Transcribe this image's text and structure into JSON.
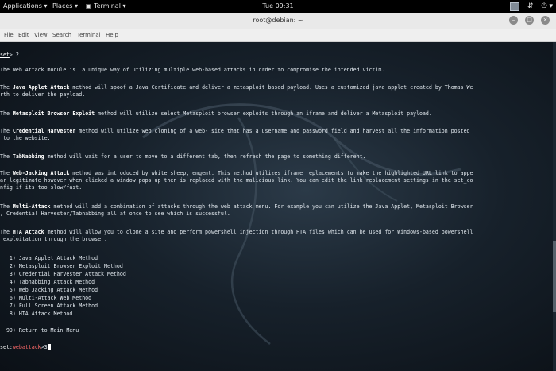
{
  "topbar": {
    "applications": "Applications ▾",
    "places": "Places ▾",
    "terminal": "▣ Terminal ▾",
    "clock": "Tue 09:31",
    "tray_network": "⇵",
    "tray_power": "⏻ ▾"
  },
  "window": {
    "title": "root@debian: ~",
    "minimize": "–",
    "maximize": "□",
    "close": "×"
  },
  "menubar": {
    "file": "File",
    "edit": "Edit",
    "view": "View",
    "search": "Search",
    "terminal": "Terminal",
    "help": "Help"
  },
  "terminal": {
    "prompt1_label": "set",
    "prompt1_suffix": "> 2",
    "intro": "The Web Attack module is  a unique way of utilizing multiple web-based attacks in order to compromise the intended victim.",
    "java_name": "Java Applet Attack",
    "java_a": "The ",
    "java_b": " method will spoof a Java Certificate and deliver a metasploit based payload. Uses a customized java applet created by Thomas We",
    "java_c": "rth to deliver the payload.",
    "msf_a": "The ",
    "msf_name": "Metasploit Browser Exploit",
    "msf_b": " method will utilize select Metasploit browser exploits through an iframe and deliver a Metasploit payload.",
    "cred_a": "The ",
    "cred_name": "Credential Harvester",
    "cred_b": " method will utilize web cloning of a web- site that has a username and password field and harvest all the information posted",
    "cred_c": " to the website.",
    "tab_a": "The ",
    "tab_name": "TabNabbing",
    "tab_b": " method will wait for a user to move to a different tab, then refresh the page to something different.",
    "wj_a": "The ",
    "wj_name": "Web-Jacking Attack",
    "wj_b": " method was introduced by white sheep, emgent. This method utilizes iframe replacements to make the highlighted URL link to appe",
    "wj_c": "ar legitimate however when clicked a window pops up then is replaced with the malicious link. You can edit the link replacement settings in the set_co",
    "wj_d": "nfig if its too slow/fast.",
    "multi_a": "The ",
    "multi_name": "Multi-Attack",
    "multi_b": " method will add a combination of attacks through the web attack menu. For example you can utilize the Java Applet, Metasploit Browser",
    "multi_c": ", Credential Harvester/Tabnabbing all at once to see which is successful.",
    "hta_a": "The ",
    "hta_name": "HTA Attack",
    "hta_b": " method will allow you to clone a site and perform powershell injection through HTA files which can be used for Windows-based powershell",
    "hta_c": " exploitation through the browser.",
    "menu": [
      "   1) Java Applet Attack Method",
      "   2) Metasploit Browser Exploit Method",
      "   3) Credential Harvester Attack Method",
      "   4) Tabnabbing Attack Method",
      "   5) Web Jacking Attack Method",
      "   6) Multi-Attack Web Method",
      "   7) Full Screen Attack Method",
      "   8) HTA Attack Method"
    ],
    "return_item": "  99) Return to Main Menu",
    "prompt2_set": "set",
    "prompt2_colon": ":",
    "prompt2_module": "webattack",
    "prompt2_suffix": ">3"
  }
}
